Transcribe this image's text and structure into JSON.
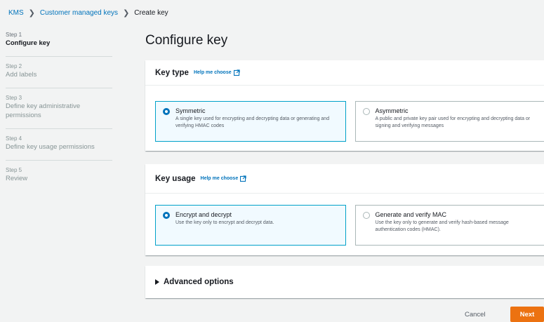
{
  "breadcrumb": {
    "items": [
      "KMS",
      "Customer managed keys"
    ],
    "current": "Create key"
  },
  "steps": [
    {
      "num": "Step 1",
      "title": "Configure key"
    },
    {
      "num": "Step 2",
      "title": "Add labels"
    },
    {
      "num": "Step 3",
      "title": "Define key administrative permissions"
    },
    {
      "num": "Step 4",
      "title": "Define key usage permissions"
    },
    {
      "num": "Step 5",
      "title": "Review"
    }
  ],
  "main": {
    "title": "Configure key",
    "key_type": {
      "heading": "Key type",
      "help": "Help me choose",
      "options": [
        {
          "title": "Symmetric",
          "desc": "A single key used for encrypting and decrypting data or generating and verifying HMAC codes",
          "selected": true
        },
        {
          "title": "Asymmetric",
          "desc": "A public and private key pair used for encrypting and decrypting data or signing and verifying messages",
          "selected": false
        }
      ]
    },
    "key_usage": {
      "heading": "Key usage",
      "help": "Help me choose",
      "options": [
        {
          "title": "Encrypt and decrypt",
          "desc": "Use the key only to encrypt and decrypt data.",
          "selected": true
        },
        {
          "title": "Generate and verify MAC",
          "desc": "Use the key only to generate and verify hash-based message authentication codes (HMAC).",
          "selected": false
        }
      ]
    },
    "advanced": {
      "label": "Advanced options"
    }
  },
  "footer": {
    "cancel": "Cancel",
    "next": "Next"
  },
  "colors": {
    "link": "#0073bb",
    "primary_button": "#ec7211",
    "selected_border": "#00a1c9",
    "selected_bg": "#f1faff"
  }
}
